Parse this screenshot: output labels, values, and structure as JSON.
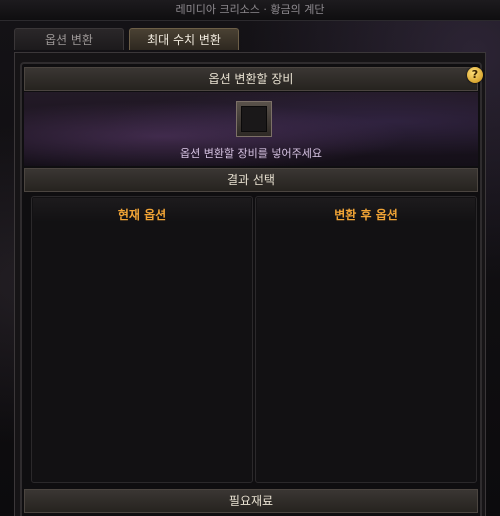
{
  "window": {
    "title": "레미디아 크리소스 · 황금의 계단"
  },
  "tabs": [
    {
      "label": "옵션 변환",
      "active": false
    },
    {
      "label": "최대 수치 변환",
      "active": true
    }
  ],
  "equipment": {
    "header": "옵션 변환할 장비",
    "hint": "옵션 변환할 장비를 넣어주세요",
    "help_icon_glyph": "?"
  },
  "result": {
    "header": "결과 선택",
    "current_title": "현재 옵션",
    "after_title": "변환 후 옵션"
  },
  "materials": {
    "header": "필요재료"
  },
  "colors": {
    "accent_orange": "#f1a436",
    "hint_purple": "#d6c3e2",
    "help_gold": "#ffd24a"
  }
}
